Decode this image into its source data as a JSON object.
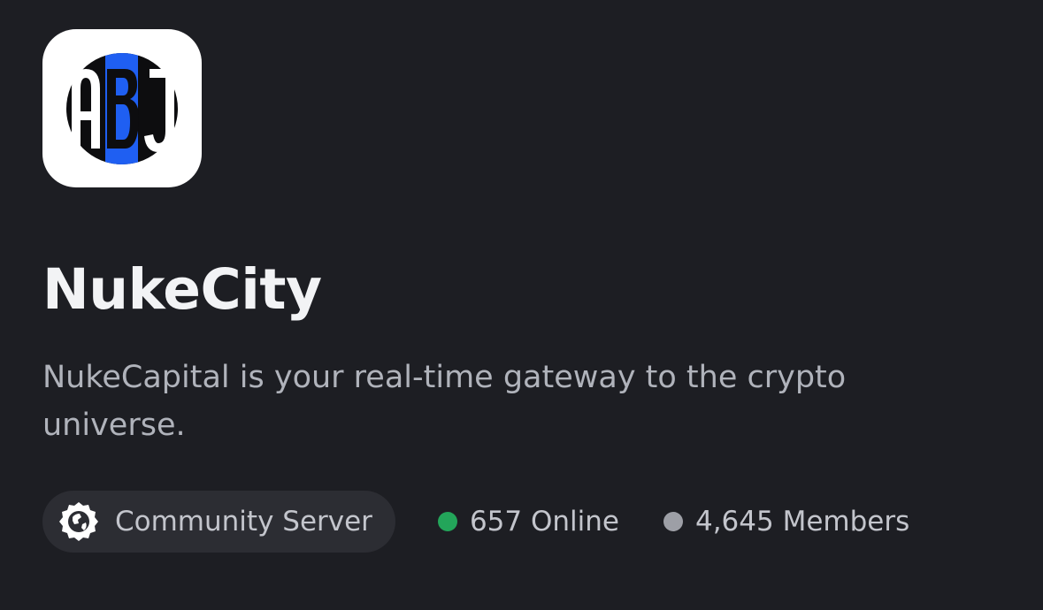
{
  "server": {
    "logo_text": "ABJ",
    "name": "NukeCity",
    "description": "NukeCapital is your real-time gateway to the crypto universe."
  },
  "meta": {
    "community_label": "Community Server",
    "community_icon": "globe-badge-icon",
    "online_text": "657 Online",
    "members_text": "4,645 Members"
  },
  "colors": {
    "background": "#1d1e23",
    "online_dot": "#23a55a",
    "members_dot": "#9d9fa6",
    "logo_blue": "#1f5ff2"
  }
}
